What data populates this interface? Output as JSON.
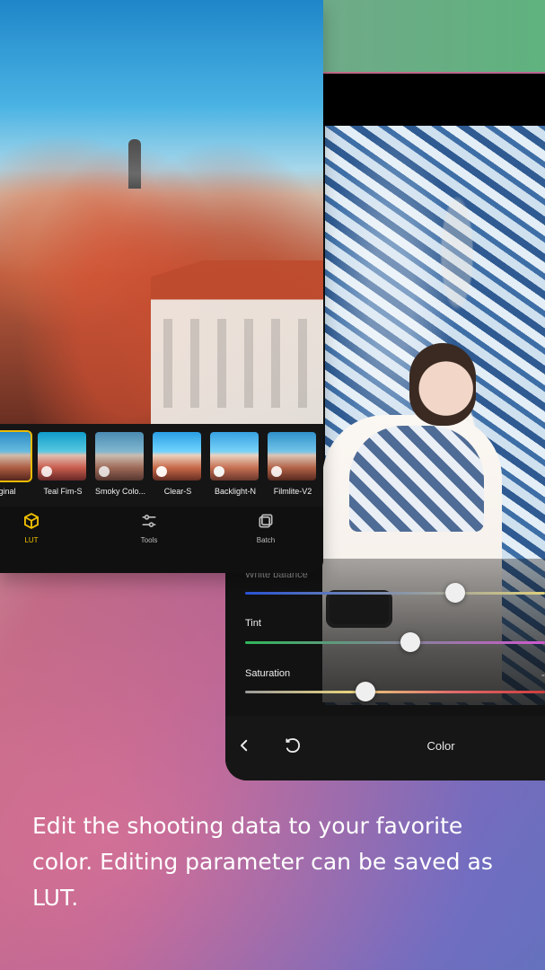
{
  "phone_right": {
    "sliders": [
      {
        "label": "White balance",
        "value_fraction": 0.7,
        "track": "linear-gradient(90deg,#2a55d8 0%,#e0d07d 100%)"
      },
      {
        "label": "Tint",
        "value_fraction": 0.55,
        "track": "linear-gradient(90deg,#2fb65a 0%,#cf58cf 100%)"
      },
      {
        "label": "Saturation",
        "value_fraction": 0.4,
        "track": "linear-gradient(90deg,#9a9a9a 0%,#e7d37d 35%,#e06a6a 70%,#cf3d3d 100%)"
      }
    ],
    "right_edge_text": "-",
    "bottom_bar": {
      "back_icon": "chevron-left-icon",
      "undo_icon": "undo-icon",
      "title": "Color"
    }
  },
  "phone_left": {
    "lut_items": [
      {
        "label": "iginal",
        "style": "original",
        "selected": true
      },
      {
        "label": "Teal Fim-S",
        "style": "teal",
        "selected": false
      },
      {
        "label": "Smoky Colo...",
        "style": "smoky",
        "selected": false
      },
      {
        "label": "Clear-S",
        "style": "clear",
        "selected": false
      },
      {
        "label": "Backlight-N",
        "style": "backlight",
        "selected": false
      },
      {
        "label": "Filmlite-V2",
        "style": "filmlite",
        "selected": false
      }
    ],
    "nav": [
      {
        "label": "LUT",
        "icon": "cube-icon",
        "active": true
      },
      {
        "label": "Tools",
        "icon": "sliders-icon",
        "active": false
      },
      {
        "label": "Batch",
        "icon": "stack-icon",
        "active": false
      }
    ]
  },
  "caption": "Edit the shooting data to your favorite color. Editing parameter can be saved as LUT.",
  "colors": {
    "accent_yellow": "#f2c200",
    "dark_ui": "#141414"
  }
}
